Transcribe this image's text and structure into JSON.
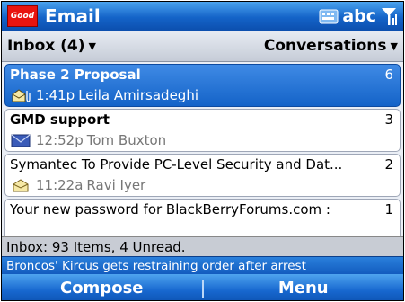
{
  "titlebar": {
    "logo_text": "Good",
    "app_title": "Email",
    "input_mode": "abc",
    "icons": [
      "keyboard-icon",
      "signal-icon"
    ]
  },
  "subheader": {
    "folder_label": "Inbox (4)",
    "view_label": "Conversations"
  },
  "messages": [
    {
      "subject": "Phase 2 Proposal",
      "count": "6",
      "time": "1:41p",
      "sender": "Leila Amirsadeghi",
      "icon": "open-envelope-attachment-icon",
      "selected": true,
      "bold": true
    },
    {
      "subject": "GMD support",
      "count": "3",
      "time": "12:52p",
      "sender": "Tom Buxton",
      "icon": "closed-envelope-icon",
      "selected": false,
      "bold": true
    },
    {
      "subject": "Symantec To Provide PC-Level Security and Dat...",
      "count": "2",
      "time": "11:22a",
      "sender": "Ravi Iyer",
      "icon": "open-envelope-icon",
      "selected": false,
      "bold": false
    },
    {
      "subject": "Your new password for BlackBerryForums.com :",
      "count": "1",
      "time": "",
      "sender": "",
      "icon": "",
      "selected": false,
      "bold": false
    }
  ],
  "status": {
    "inbox_summary": "Inbox: 93 Items, 4 Unread."
  },
  "ticker": {
    "headline": "Broncos' Kircus gets restraining order after arrest"
  },
  "softkeys": {
    "left": "Compose",
    "right": "Menu"
  },
  "colors": {
    "title_blue": "#1463c8",
    "selected_blue": "#3f8ae5",
    "logo_red": "#e8140f"
  }
}
